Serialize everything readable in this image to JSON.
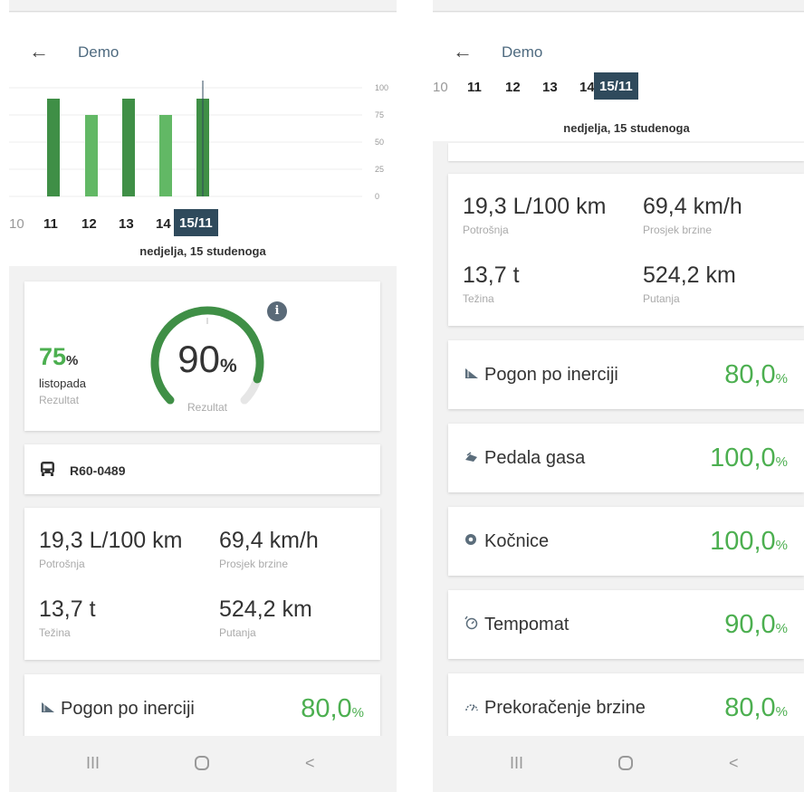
{
  "app": {
    "title": "Demo"
  },
  "chart_data": {
    "type": "bar",
    "categories": [
      "11",
      "12",
      "13",
      "14",
      "15/11"
    ],
    "values": [
      90,
      75,
      90,
      75,
      90
    ],
    "y_ticks": [
      "100",
      "75",
      "50",
      "25",
      "0"
    ],
    "ylim": [
      0,
      100
    ],
    "grid": true,
    "colors": [
      "#3f8f46",
      "#62b865",
      "#3f8f46",
      "#62b865",
      "#3f8f46"
    ]
  },
  "date_selector": {
    "prev": "10",
    "d11": "11",
    "d12": "12",
    "d13": "13",
    "d14": "14",
    "selected": "15/11"
  },
  "day_label": "nedjelja, 15 studenoga",
  "score": {
    "prev_value": "75",
    "percent_sign": "%",
    "prev_month": "listopada",
    "prev_label": "Rezultat",
    "gauge_value": "90",
    "gauge_label": "Rezultat",
    "gauge_fraction": 0.9
  },
  "vehicle": {
    "plate": "R60-0489"
  },
  "stats": {
    "consumption_value": "19,3 L/100 km",
    "consumption_label": "Potrošnja",
    "speed_value": "69,4 km/h",
    "speed_label": "Prosjek brzine",
    "weight_value": "13,7 t",
    "weight_label": "Težina",
    "distance_value": "524,2 km",
    "distance_label": "Putanja"
  },
  "metrics": [
    {
      "name": "Pogon po inerciji",
      "value": "80,0",
      "unit": "%",
      "icon": "coasting-icon"
    },
    {
      "name": "Pedala gasa",
      "value": "100,0",
      "unit": "%",
      "icon": "gas-pedal-icon"
    },
    {
      "name": "Kočnice",
      "value": "100,0",
      "unit": "%",
      "icon": "brake-icon"
    },
    {
      "name": "Tempomat",
      "value": "90,0",
      "unit": "%",
      "icon": "cruise-control-icon"
    },
    {
      "name": "Prekoračenje brzine",
      "value": "80,0",
      "unit": "%",
      "icon": "speeding-icon"
    }
  ],
  "navbar": {
    "recent": "III",
    "home": "O",
    "back": "<"
  },
  "icons": {
    "back": "←",
    "info": "i",
    "bus": "bus-icon"
  }
}
